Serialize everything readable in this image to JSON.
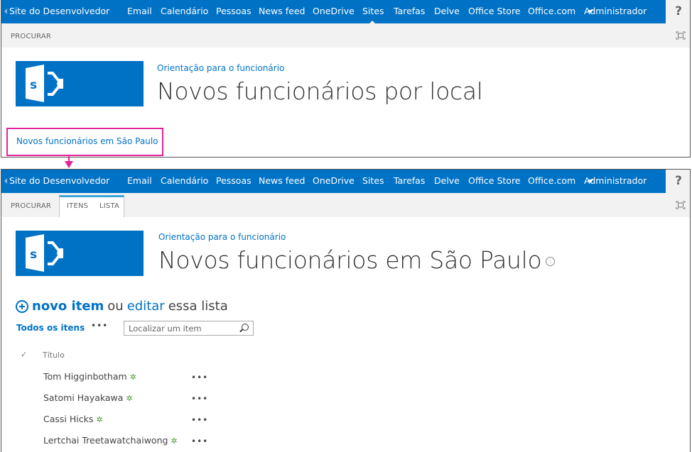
{
  "suite_bar": {
    "site_name": "Site do Desenvolvedor",
    "nav_items": [
      "Email",
      "Calendário",
      "Pessoas",
      "News feed",
      "OneDrive",
      "Sites",
      "Tarefas",
      "Delve",
      "Office Store",
      "Office.com",
      "Administrador"
    ],
    "active_item": "Sites",
    "help_label": "?",
    "brand_color": "#0072c6"
  },
  "screen1": {
    "ribbon_tabs": [
      "PROCURAR"
    ],
    "breadcrumb": "Orientação para o funcionário",
    "title": "Novos funcionários por local",
    "link": "Novos funcionários em São Paulo"
  },
  "screen2": {
    "ribbon_tabs": [
      "PROCURAR",
      "ITENS",
      "LISTA"
    ],
    "breadcrumb": "Orientação para o funcionário",
    "title": "Novos funcionários em São Paulo",
    "new_item": {
      "new_label": "novo item",
      "or_label": "ou",
      "edit_label": "editar",
      "suffix": "essa lista"
    },
    "view_label": "Todos os itens",
    "more_label": "•••",
    "search_placeholder": "Localizar um item",
    "column_header": "Título",
    "check_glyph": "✓",
    "rows": [
      {
        "title": "Tom Higginbotham"
      },
      {
        "title": "Satomi Hayakawa"
      },
      {
        "title": "Cassi Hicks"
      },
      {
        "title": "Lertchai Treetawatchaiwong"
      }
    ],
    "new_badge": "✲",
    "row_more": "•••"
  },
  "annotation_color": "#e3239a"
}
